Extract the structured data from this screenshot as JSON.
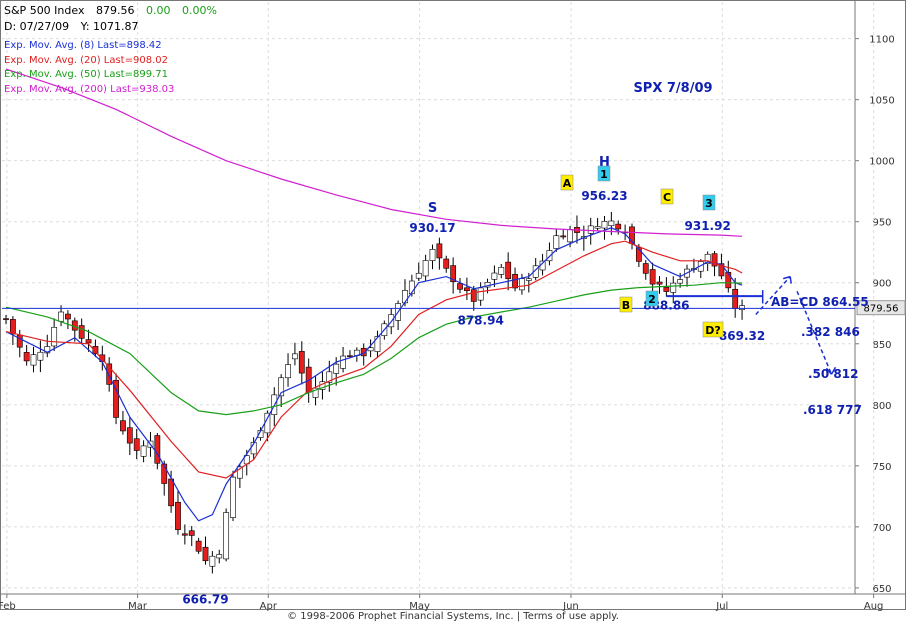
{
  "header": {
    "symbol": "S&P 500 Index",
    "last": "879.56",
    "change": "0.00",
    "change_pct": "0.00%",
    "cursor_date": "D: 07/27/09",
    "cursor_y": "Y: 1071.87"
  },
  "legend": [
    {
      "label": "Exp. Mov. Avg. (8) Last=898.42",
      "color": "#1a2fd6"
    },
    {
      "label": "Exp. Mov. Avg. (20) Last=908.02",
      "color": "#e02020"
    },
    {
      "label": "Exp. Mov. Avg. (50) Last=899.71",
      "color": "#18a018"
    },
    {
      "label": "Exp. Mov. Avg. (200) Last=938.03",
      "color": "#d020d0"
    }
  ],
  "footer": "© 1998-2006 Prophet Financial Systems, Inc.  |  Terms of use apply.",
  "chart_data": {
    "type": "candlestick",
    "title": "SPX 7/8/09",
    "x_labels": [
      "Feb",
      "Mar",
      "Apr",
      "May",
      "Jun",
      "Jul",
      "Aug"
    ],
    "y_ticks": [
      650,
      700,
      750,
      800,
      850,
      900,
      950,
      1000,
      1050,
      1100
    ],
    "ylim": [
      645,
      1130
    ],
    "last_price_label": "879.56",
    "price_path": [
      [
        0,
        870
      ],
      [
        3,
        835
      ],
      [
        6,
        850
      ],
      [
        8,
        878
      ],
      [
        10,
        862
      ],
      [
        14,
        838
      ],
      [
        16,
        790
      ],
      [
        19,
        760
      ],
      [
        21,
        772
      ],
      [
        23,
        735
      ],
      [
        25,
        700
      ],
      [
        27,
        692
      ],
      [
        29,
        672
      ],
      [
        31,
        680
      ],
      [
        33,
        740
      ],
      [
        36,
        768
      ],
      [
        38,
        795
      ],
      [
        40,
        822
      ],
      [
        42,
        842
      ],
      [
        44,
        810
      ],
      [
        46,
        818
      ],
      [
        48,
        836
      ],
      [
        50,
        842
      ],
      [
        52,
        842
      ],
      [
        54,
        854
      ],
      [
        56,
        874
      ],
      [
        58,
        894
      ],
      [
        60,
        910
      ],
      [
        62,
        926
      ],
      [
        64,
        910
      ],
      [
        66,
        896
      ],
      [
        68,
        886
      ],
      [
        70,
        900
      ],
      [
        72,
        912
      ],
      [
        74,
        896
      ],
      [
        76,
        906
      ],
      [
        78,
        918
      ],
      [
        80,
        938
      ],
      [
        82,
        943
      ],
      [
        84,
        940
      ],
      [
        86,
        949
      ],
      [
        88,
        950
      ],
      [
        90,
        944
      ],
      [
        92,
        920
      ],
      [
        94,
        900
      ],
      [
        96,
        893
      ],
      [
        98,
        905
      ],
      [
        100,
        914
      ],
      [
        102,
        922
      ],
      [
        104,
        906
      ],
      [
        106,
        880
      ],
      [
        107,
        879
      ]
    ],
    "series": [
      {
        "name": "Exp. Mov. Avg. (8)",
        "color": "#1a2fd6",
        "points": [
          [
            0,
            860
          ],
          [
            6,
            843
          ],
          [
            10,
            855
          ],
          [
            14,
            835
          ],
          [
            18,
            790
          ],
          [
            22,
            760
          ],
          [
            26,
            720
          ],
          [
            28,
            705
          ],
          [
            30,
            710
          ],
          [
            32,
            735
          ],
          [
            36,
            768
          ],
          [
            40,
            810
          ],
          [
            44,
            820
          ],
          [
            48,
            835
          ],
          [
            52,
            842
          ],
          [
            56,
            868
          ],
          [
            60,
            900
          ],
          [
            64,
            905
          ],
          [
            68,
            895
          ],
          [
            72,
            900
          ],
          [
            76,
            905
          ],
          [
            80,
            927
          ],
          [
            84,
            937
          ],
          [
            88,
            945
          ],
          [
            90,
            940
          ],
          [
            94,
            915
          ],
          [
            98,
            905
          ],
          [
            102,
            917
          ],
          [
            104,
            915
          ],
          [
            106,
            900
          ],
          [
            107,
            898
          ]
        ]
      },
      {
        "name": "Exp. Mov. Avg. (20)",
        "color": "#e02020",
        "points": [
          [
            0,
            860
          ],
          [
            6,
            852
          ],
          [
            12,
            850
          ],
          [
            18,
            812
          ],
          [
            24,
            770
          ],
          [
            28,
            745
          ],
          [
            32,
            740
          ],
          [
            36,
            755
          ],
          [
            40,
            790
          ],
          [
            44,
            812
          ],
          [
            48,
            822
          ],
          [
            52,
            830
          ],
          [
            56,
            848
          ],
          [
            60,
            874
          ],
          [
            64,
            886
          ],
          [
            68,
            892
          ],
          [
            72,
            895
          ],
          [
            76,
            898
          ],
          [
            80,
            910
          ],
          [
            84,
            922
          ],
          [
            88,
            932
          ],
          [
            90,
            934
          ],
          [
            94,
            925
          ],
          [
            98,
            918
          ],
          [
            102,
            918
          ],
          [
            104,
            914
          ],
          [
            106,
            911
          ],
          [
            107,
            908
          ]
        ]
      },
      {
        "name": "Exp. Mov. Avg. (50)",
        "color": "#18a018",
        "points": [
          [
            0,
            880
          ],
          [
            6,
            872
          ],
          [
            12,
            860
          ],
          [
            18,
            842
          ],
          [
            24,
            810
          ],
          [
            28,
            795
          ],
          [
            32,
            792
          ],
          [
            36,
            795
          ],
          [
            40,
            800
          ],
          [
            44,
            810
          ],
          [
            48,
            818
          ],
          [
            52,
            825
          ],
          [
            56,
            838
          ],
          [
            60,
            855
          ],
          [
            64,
            866
          ],
          [
            68,
            872
          ],
          [
            72,
            876
          ],
          [
            76,
            880
          ],
          [
            80,
            885
          ],
          [
            84,
            890
          ],
          [
            88,
            894
          ],
          [
            92,
            896
          ],
          [
            96,
            897
          ],
          [
            100,
            898
          ],
          [
            104,
            900
          ],
          [
            107,
            899.71
          ]
        ]
      },
      {
        "name": "Exp. Mov. Avg. (200)",
        "color": "#d020d0",
        "points": [
          [
            0,
            1075
          ],
          [
            8,
            1060
          ],
          [
            16,
            1042
          ],
          [
            24,
            1020
          ],
          [
            32,
            1000
          ],
          [
            40,
            985
          ],
          [
            48,
            972
          ],
          [
            56,
            960
          ],
          [
            64,
            952
          ],
          [
            72,
            947
          ],
          [
            80,
            944
          ],
          [
            88,
            942
          ],
          [
            96,
            940
          ],
          [
            104,
            939
          ],
          [
            107,
            938.03
          ]
        ]
      }
    ],
    "ab_cd_line": 864.55,
    "annotations": [
      {
        "text": "930.17",
        "x": 62,
        "y": 930.17,
        "color": "#1020b0"
      },
      {
        "text": "S",
        "x": 62,
        "y": 930.17,
        "color": "#1020b0"
      },
      {
        "text": "878.94",
        "x": 69,
        "y": 878.94,
        "color": "#1020b0"
      },
      {
        "text": "956.23",
        "x": 87,
        "y": 956.23,
        "color": "#1020b0"
      },
      {
        "text": "H",
        "x": 87,
        "y": 956.23,
        "color": "#1020b0"
      },
      {
        "text": "888.86",
        "x": 96,
        "y": 888.86,
        "color": "#1020b0"
      },
      {
        "text": "931.92",
        "x": 102,
        "y": 931.92,
        "color": "#1020b0"
      },
      {
        "text": "S",
        "x": 102,
        "y": 931.92,
        "color": "#1020b0"
      },
      {
        "text": "869.32",
        "x": 107,
        "y": 869.32,
        "color": "#1020b0"
      },
      {
        "text": "666.79",
        "x": 29,
        "y": 666.79,
        "color": "#1020b0"
      },
      {
        "text": "AB=CD 864.55",
        "x": 117,
        "y": 864.55,
        "color": "#1020b0"
      },
      {
        "text": ".382 846",
        "x": 122,
        "y": 846,
        "color": "#1020b0"
      },
      {
        "text": ".50 812",
        "x": 122,
        "y": 812,
        "color": "#1020b0"
      },
      {
        "text": ".618 777",
        "x": 122,
        "y": 777,
        "color": "#1020b0"
      }
    ],
    "markers": [
      {
        "text": "A",
        "bg": "#ffee00"
      },
      {
        "text": "1",
        "bg": "#33ccee"
      },
      {
        "text": "C",
        "bg": "#ffee00"
      },
      {
        "text": "3",
        "bg": "#33ccee"
      },
      {
        "text": "B",
        "bg": "#ffee00"
      },
      {
        "text": "2",
        "bg": "#33ccee"
      },
      {
        "text": "D?",
        "bg": "#ffee00"
      }
    ]
  }
}
